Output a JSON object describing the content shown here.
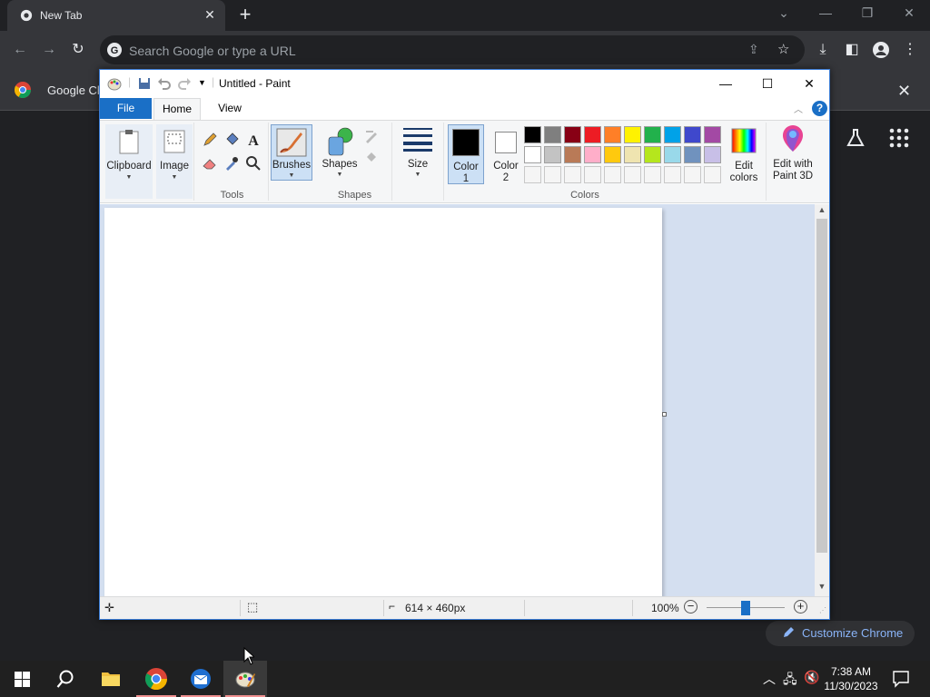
{
  "chrome": {
    "tab_title": "New Tab",
    "omnibox_placeholder": "Search Google or type a URL",
    "bookmark_label": "Google Ch",
    "customize_label": "Customize Chrome"
  },
  "paint": {
    "window_title": "Untitled - Paint",
    "tabs": {
      "file": "File",
      "home": "Home",
      "view": "View"
    },
    "ribbon": {
      "clipboard": "Clipboard",
      "image": "Image",
      "tools": "Tools",
      "brushes": "Brushes",
      "shapes_btn": "Shapes",
      "shapes_group": "Shapes",
      "size": "Size",
      "color1_a": "Color",
      "color1_b": "1",
      "color2_a": "Color",
      "color2_b": "2",
      "colors_group": "Colors",
      "edit_colors_a": "Edit",
      "edit_colors_b": "colors",
      "paint3d_a": "Edit with",
      "paint3d_b": "Paint 3D"
    },
    "colors": {
      "color1": "#000000",
      "color2": "#ffffff",
      "row1": [
        "#000000",
        "#7f7f7f",
        "#880015",
        "#ed1c24",
        "#ff7f27",
        "#fff200",
        "#22b14c",
        "#00a2e8",
        "#3f48cc",
        "#a349a4"
      ],
      "row2": [
        "#ffffff",
        "#c3c3c3",
        "#b97a57",
        "#ffaec9",
        "#ffc90e",
        "#efe4b0",
        "#b5e61d",
        "#99d9ea",
        "#7092be",
        "#c8bfe7"
      ],
      "row3": [
        "#f5f5f5",
        "#f5f5f5",
        "#f5f5f5",
        "#f5f5f5",
        "#f5f5f5",
        "#f5f5f5",
        "#f5f5f5",
        "#f5f5f5",
        "#f5f5f5",
        "#f5f5f5"
      ]
    },
    "status": {
      "canvas_size": "614 × 460px",
      "zoom": "100%"
    }
  },
  "taskbar": {
    "time": "7:38 AM",
    "date": "11/30/2023"
  }
}
